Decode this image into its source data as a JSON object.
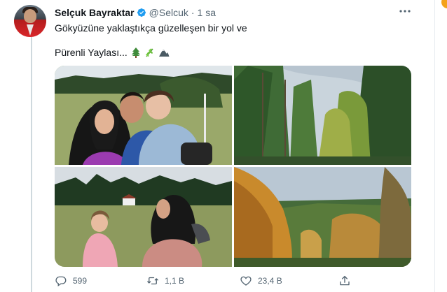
{
  "tweet": {
    "author_name": "Selçuk Bayraktar",
    "handle": "@Selcuk",
    "separator": "·",
    "time": "1 sa",
    "line1": "Gökyüzüne yaklaştıkça güzelleşen bir yol ve",
    "line2": "Pürenli Yaylası...",
    "emojis": [
      "evergreen-tree-emoji",
      "herb-emoji",
      "mountain-emoji"
    ]
  },
  "media": [
    {
      "id": "photo-1",
      "subject": "selfie-family-meadow"
    },
    {
      "id": "photo-2",
      "subject": "tall-trees-sky"
    },
    {
      "id": "photo-3",
      "subject": "woman-child-forest"
    },
    {
      "id": "photo-4",
      "subject": "autumn-forest"
    }
  ],
  "actions": {
    "reply_count": "599",
    "retweet_count": "1,1 B",
    "like_count": "23,4 B"
  },
  "colors": {
    "text": "#0f1419",
    "muted": "#536471",
    "verified": "#1d9bf0",
    "divider": "#cfd9de"
  }
}
